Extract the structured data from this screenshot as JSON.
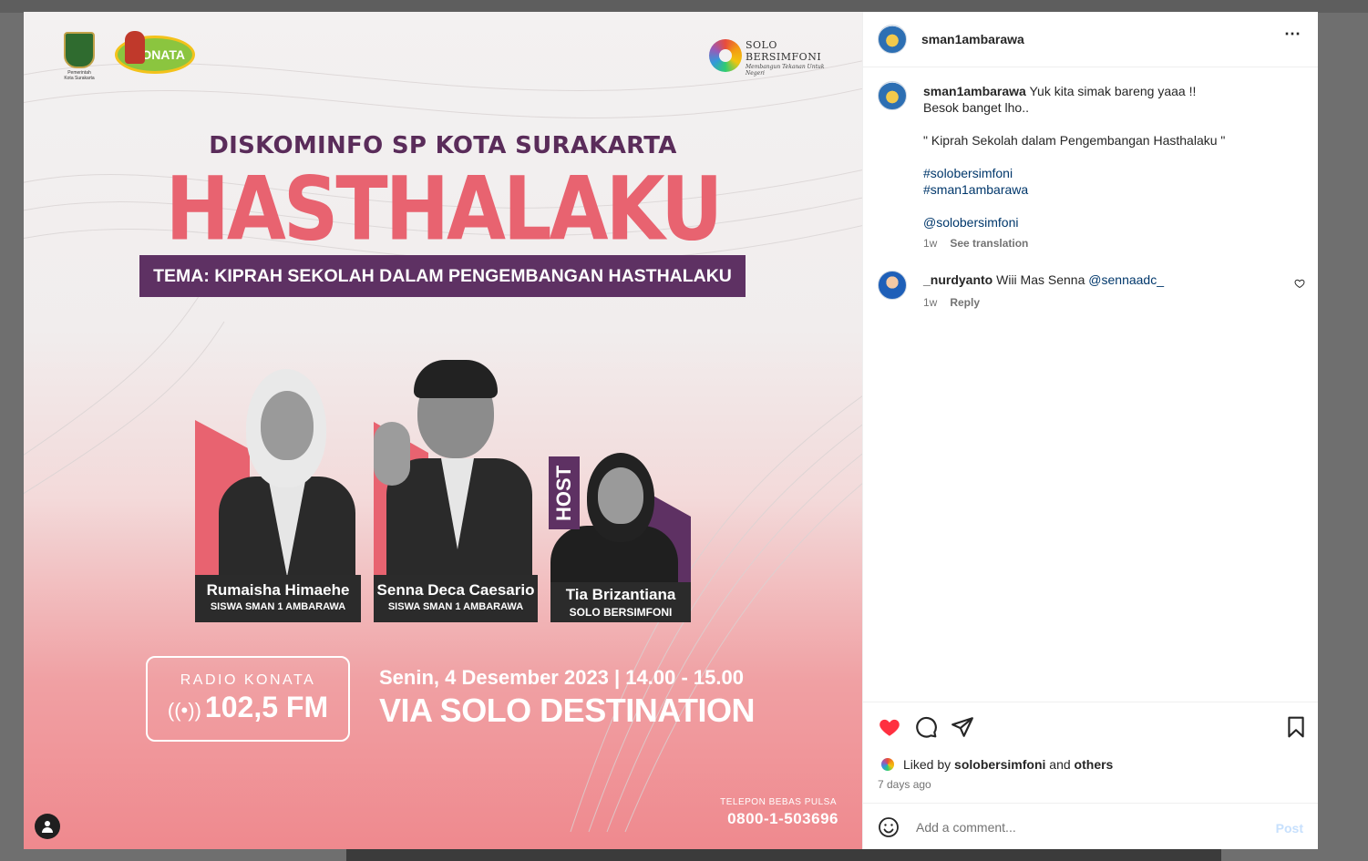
{
  "poster": {
    "logo_pemkot_caption": "Pemerintah Kota Surakarta",
    "logo_konata": "KONATA",
    "logo_solo_line1": "SOLO",
    "logo_solo_line2": "BERSIMFONI",
    "logo_solo_tagline": "Membangun Tekanan Untuk Negeri",
    "org": "DISKOMINFO SP KOTA SURAKARTA",
    "title": "HASTHALAKU",
    "theme": "TEMA:  KIPRAH SEKOLAH DALAM PENGEMBANGAN HASTHALAKU",
    "speakers": [
      {
        "name": "Rumaisha Himaehe",
        "role": "SISWA SMAN 1 AMBARAWA"
      },
      {
        "name": "Senna Deca Caesario",
        "role": "SISWA SMAN 1 AMBARAWA"
      },
      {
        "name": "Tia Brizantiana",
        "role": "SOLO BERSIMFONI"
      }
    ],
    "host_label": "HOST",
    "radio_label": "RADIO KONATA",
    "radio_freq": "102,5 FM",
    "date": "Senin, 4 Desember 2023 | 14.00 - 15.00",
    "via": "VIA SOLO DESTINATION",
    "tel_label": "TELEPON BEBAS PULSA",
    "tel_number": "0800-1-503696",
    "colors": {
      "accent": "#e86370",
      "purple": "#5e3163"
    }
  },
  "post": {
    "username": "sman1ambarawa",
    "more_icon": "⋯",
    "caption_lines": [
      "Yuk kita simak bareng yaaa !!",
      "Besok banget lho..",
      "",
      "\" Kiprah Sekolah dalam Pengembangan Hasthalaku \""
    ],
    "hashtags": [
      "#solobersimfoni",
      "#sman1ambarawa"
    ],
    "mention": "@solobersimfoni",
    "caption_time": "1w",
    "see_translation": "See translation",
    "comment": {
      "username": "_nurdyanto",
      "text": "Wiii Mas Senna",
      "mention": "@sennaadc_",
      "time": "1w",
      "reply": "Reply"
    },
    "liked_by_prefix": "Liked by",
    "liked_by_user": "solobersimfoni",
    "liked_by_and": "and",
    "liked_by_others": "others",
    "posted_ago": "7 days ago",
    "comment_placeholder": "Add a comment...",
    "post_button": "Post"
  }
}
